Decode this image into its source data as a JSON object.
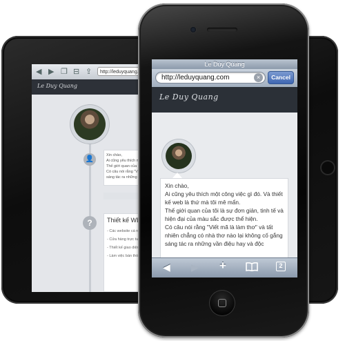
{
  "iphone": {
    "title": "Le Duy Quang",
    "url": "http://leduyquang.com",
    "cancel_label": "Cancel",
    "clear_icon": "×",
    "site_logo": "Le Duy Quang",
    "intro_lines": [
      "Xin chào,",
      "Ai cũng yêu thích một công việc gì đó. Và thiết kế web là thứ mà tôi mê mẩn.",
      "Thế giới quan của tôi là sự đơn giản, tinh tế và hiện đại của màu sắc được thể hiện.",
      "Có câu nói rằng \"Viết mã là làm thơ\" và tất nhiên chẳng có nhà thơ nào lại không cố gắng sáng tác ra những vần điệu hay và độc"
    ],
    "toolbar": {
      "back": "◀",
      "forward": "▶",
      "add": "+",
      "bookmarks": "📖",
      "pages": "2"
    }
  },
  "ipad": {
    "url": "http://leduyquang.com",
    "site_logo": "Le Duy Quang",
    "card_lines": [
      "Xin chào,",
      "Ai cũng yêu thích một c",
      "Thế giới quan của tôi là",
      "Có câu nói rằng \"Viết m",
      "sáng tác ra những vần"
    ],
    "section_title": "Thiết kế WEB",
    "section_items": [
      "- Các website cá nh",
      "- Cửa hàng trực tuyế",
      "- Thiết kế giao diện",
      "- Làm việc bán thời g"
    ],
    "badge_question": "?"
  }
}
